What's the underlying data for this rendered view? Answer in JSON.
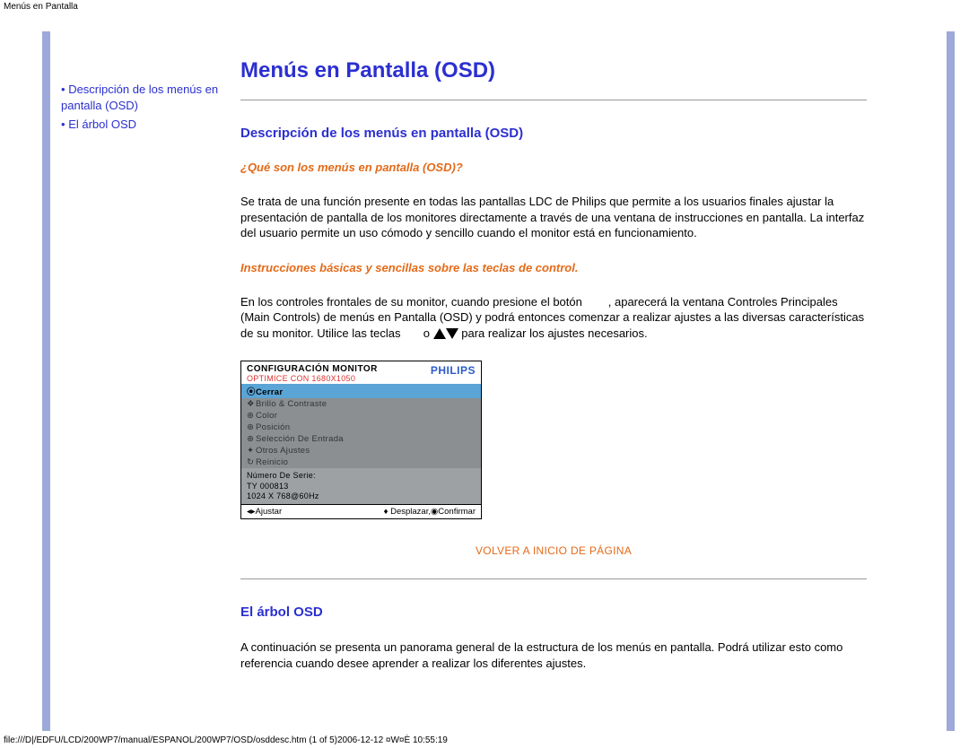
{
  "breadcrumb": "Menús en Pantalla",
  "sidebar": {
    "items": [
      {
        "bullet": "•",
        "label": "Descripción de los menús en pantalla (OSD)"
      },
      {
        "bullet": "•",
        "label": "El árbol OSD"
      }
    ]
  },
  "main": {
    "title": "Menús en Pantalla (OSD)",
    "section1_heading": "Descripción de los menús en pantalla (OSD)",
    "q1_heading": "¿Qué son los menús en pantalla (OSD)?",
    "q1_body": "Se trata de una función presente en todas las pantallas LDC de Philips que permite a los usuarios finales ajustar la presentación de pantalla de los monitores directamente a través de una ventana de instrucciones en pantalla. La interfaz del usuario permite un uso cómodo y sencillo cuando el monitor está en funcionamiento.",
    "instr_heading": "Instrucciones básicas y sencillas sobre las teclas de control.",
    "instr_body_1": "En los controles frontales de su monitor, cuando presione el botón ",
    "instr_body_2": ", aparecerá la ventana Controles Principales (Main Controls) de menús en Pantalla (OSD) y podrá entonces comenzar a realizar ajustes a las diversas características de su monitor. Utilice las teclas ",
    "instr_or": "o",
    "instr_body_3": " para realizar los ajustes necesarios.",
    "back_to_top": "VOLVER A INICIO DE PÁGINA",
    "section2_heading": "El árbol OSD",
    "section2_body": "A continuación se presenta un panorama general de la estructura de los menús en pantalla. Podrá utilizar esto como referencia cuando desee aprender a realizar los diferentes ajustes."
  },
  "osd": {
    "header_title": "CONFIGURACIÓN MONITOR",
    "header_sub": "OPTIMICE CON 1680X1050",
    "brand": "PHILIPS",
    "items": [
      {
        "glyph": "⦿",
        "label": "Cerrar",
        "hl": true
      },
      {
        "glyph": "❖",
        "label": "Brillo & Contraste",
        "hl": false
      },
      {
        "glyph": "⊕",
        "label": "Color",
        "hl": false
      },
      {
        "glyph": "⊕",
        "label": "Posición",
        "hl": false
      },
      {
        "glyph": "⊕",
        "label": "Selección De Entrada",
        "hl": false
      },
      {
        "glyph": "✦",
        "label": "Otros Ajustes",
        "hl": false
      },
      {
        "glyph": "↻",
        "label": "Reinicio",
        "hl": false
      }
    ],
    "info1": "Número De Serie:",
    "info2": "TY 000813",
    "info3": "1024 X 768@60Hz",
    "foot_left": "◂▸Ajustar",
    "foot_right": "♦ Desplazar,◉Confirmar"
  },
  "footer_path": "file:///D|/EDFU/LCD/200WP7/manual/ESPANOL/200WP7/OSD/osddesc.htm (1 of 5)2006-12-12 ¤W¤È 10:55:19"
}
